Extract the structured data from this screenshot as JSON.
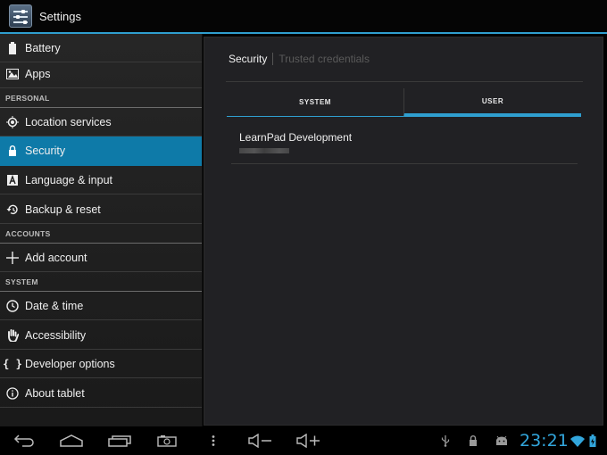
{
  "app": {
    "title": "Settings"
  },
  "sidebar": {
    "items": [
      {
        "label": "Battery",
        "icon": "battery-icon"
      },
      {
        "label": "Apps",
        "icon": "apps-icon"
      },
      {
        "label": "Location services",
        "icon": "location-icon"
      },
      {
        "label": "Security",
        "icon": "lock-icon",
        "selected": true
      },
      {
        "label": "Language & input",
        "icon": "language-icon"
      },
      {
        "label": "Backup & reset",
        "icon": "backup-icon"
      },
      {
        "label": "Add account",
        "icon": "plus-icon"
      },
      {
        "label": "Date & time",
        "icon": "clock-icon"
      },
      {
        "label": "Accessibility",
        "icon": "hand-icon"
      },
      {
        "label": "Developer options",
        "icon": "braces-icon"
      },
      {
        "label": "About tablet",
        "icon": "info-icon"
      }
    ],
    "headers": {
      "personal": "PERSONAL",
      "accounts": "ACCOUNTS",
      "system": "SYSTEM"
    }
  },
  "content": {
    "breadcrumb": {
      "current": "Security",
      "next": "Trusted credentials"
    },
    "tabs": [
      {
        "label": "SYSTEM",
        "selected": false
      },
      {
        "label": "USER",
        "selected": true
      }
    ],
    "credentials": [
      {
        "name": "LearnPad Development"
      }
    ]
  },
  "status": {
    "time": "23:21"
  },
  "colors": {
    "accent": "#2f9fd0",
    "selected_item": "#0e7aa8",
    "clock": "#32a6dc"
  }
}
